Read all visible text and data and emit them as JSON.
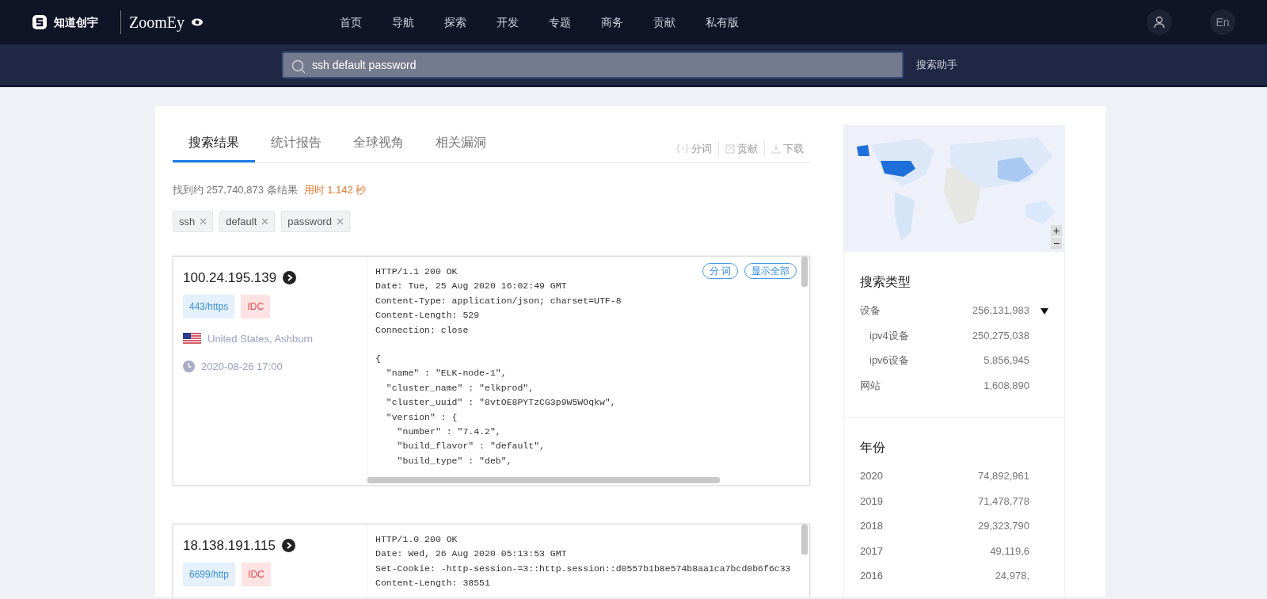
{
  "header": {
    "logo_text": "知道创宇",
    "brand": "ZoomEy",
    "nav": [
      {
        "label": "首页"
      },
      {
        "label": "导航"
      },
      {
        "label": "探索"
      },
      {
        "label": "开发"
      },
      {
        "label": "专题"
      },
      {
        "label": "商务"
      },
      {
        "label": "贡献"
      },
      {
        "label": "私有版"
      }
    ],
    "lang": "En"
  },
  "search": {
    "value": "ssh default password",
    "helper": "搜索助手"
  },
  "tabs": [
    {
      "label": "搜索结果",
      "selected": true
    },
    {
      "label": "统计报告",
      "selected": false
    },
    {
      "label": "全球视角",
      "selected": false
    },
    {
      "label": "相关漏洞",
      "selected": false
    }
  ],
  "actions": [
    {
      "label": "分词",
      "kind": "braces"
    },
    {
      "label": "贡献",
      "kind": "edit"
    },
    {
      "label": "下载",
      "kind": "download"
    }
  ],
  "summary": {
    "found": "找到约 257,740,873 条结果",
    "time": "用时 1.142 秒"
  },
  "tags": [
    "ssh",
    "default",
    "password"
  ],
  "results": [
    {
      "ip": "100.24.195.139",
      "port": "443/https",
      "label": "IDC",
      "location": "United States, Ashburn",
      "time": "2020-08-26 17:00",
      "buttons": [
        "分 词",
        "显示全部"
      ],
      "lines": [
        "HTTP/1.1 200 OK",
        "Date: Tue, 25 Aug 2020 16:02:49 GMT",
        "Content-Type: application/json; charset=UTF-8",
        "Content-Length: 529",
        "Connection: close"
      ],
      "body_lines": [
        "{",
        "  \"name\" : \"ELK-node-1\",",
        "  \"cluster_name\" : \"elkprod\",",
        "  \"cluster_uuid\" : \"8vtOE8PYTzCG3p9W5WOqkw\",",
        "  \"version\" : {",
        "    \"number\" : \"7.4.2\",",
        "    \"build_flavor\" : \"default\",",
        "    \"build_type\" : \"deb\","
      ]
    },
    {
      "ip": "18.138.191.115",
      "port": "6699/http",
      "label": "IDC",
      "lines": [
        "HTTP/1.0 200 OK",
        "Date: Wed, 26 Aug 2020 05:13:53 GMT",
        "Set-Cookie: -http-session-=3::http.session::d0557b1b8e574b8aa1ca7bcd0b6f6c33",
        "Content-Length: 38551"
      ]
    }
  ],
  "map": {
    "zoom_in": "+",
    "zoom_out": "−"
  },
  "facets": [
    {
      "title": "搜索类型",
      "items": [
        {
          "label": "设备",
          "count": "256,131,983",
          "expanded": true,
          "children": [
            {
              "label": "ipv4设备",
              "count": "250,275,038"
            },
            {
              "label": "ipv6设备",
              "count": "5,856,945"
            }
          ]
        },
        {
          "label": "网站",
          "count": "1,608,890"
        }
      ]
    },
    {
      "title": "年份",
      "items": [
        {
          "label": "2020",
          "count": "74,892,961"
        },
        {
          "label": "2019",
          "count": "71,478,778"
        },
        {
          "label": "2018",
          "count": "29,323,790"
        },
        {
          "label": "2017",
          "count": "49,119,6"
        },
        {
          "label": "2016",
          "count": "24,978,"
        }
      ]
    }
  ]
}
